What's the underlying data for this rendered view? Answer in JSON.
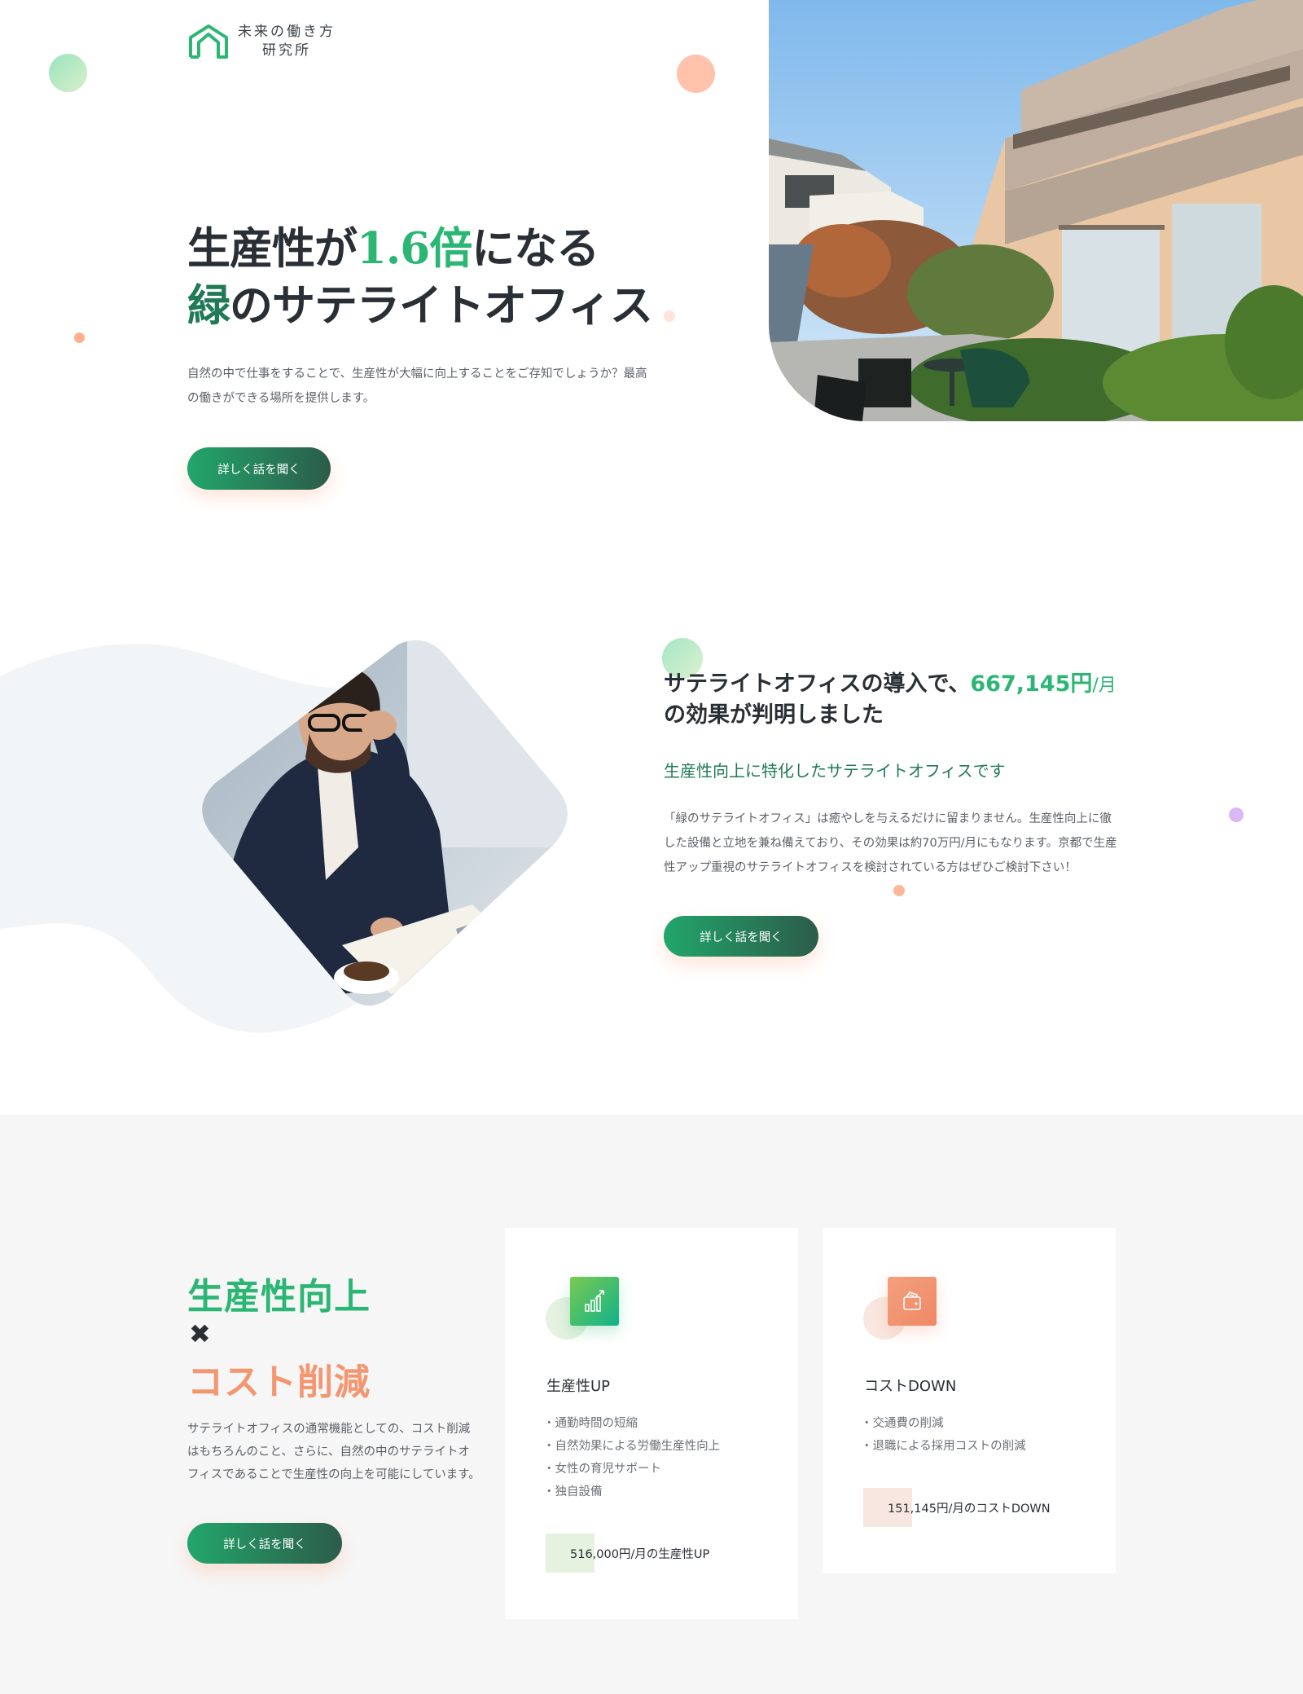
{
  "brand": {
    "name_line1": "未来の働き方",
    "name_line2": "研究所"
  },
  "hero": {
    "title_part1": "生産性が",
    "title_highlight": "1.6倍",
    "title_part2": "になる",
    "title_line2_accent": "緑",
    "title_line2_rest": "のサテライトオフィス",
    "description": "自然の中で仕事をすることで、生産性が大幅に向上することをご存知でしょうか？最高の働きができる場所を提供します。",
    "cta_label": "詳しく話を聞く"
  },
  "intro": {
    "title_part1": "サテライトオフィスの導入で、",
    "title_number": "667,145円",
    "title_unit": "/月",
    "title_line2": "の効果が判明しました",
    "subtitle": "生産性向上に特化したサテライトオフィスです",
    "description": "「緑のサテライトオフィス」は癒やしを与えるだけに留まりません。生産性向上に徹した設備と立地を兼ね備えており、その効果は約70万円/月にもなります。京都で生産性アップ重視のサテライトオフィスを検討されている方はぜひご検討下さい！",
    "cta_label": "詳しく話を聞く"
  },
  "features": {
    "heading_1": "生産性向上",
    "heading_x": "✖",
    "heading_2": "コスト削減",
    "description": "サテライトオフィスの通常機能としての、コスト削減はもちろんのこと、さらに、自然の中のサテライトオフィスであることで生産性の向上を可能にしています。",
    "cta_label": "詳しく話を聞く",
    "cards": [
      {
        "icon": "chart-up-icon",
        "title": "生産性UP",
        "items": [
          "通勤時間の短縮",
          "自然効果による労働生産性向上",
          "女性の育児サポート",
          "独自設備"
        ],
        "footer": "516,000円/月の生産性UP"
      },
      {
        "icon": "wallet-icon",
        "title": "コストDOWN",
        "items": [
          "交通費の削減",
          "退職による採用コストの削減"
        ],
        "footer": "151,145円/月のコストDOWN"
      }
    ]
  },
  "colors": {
    "brand_green": "#2bb673",
    "dark_green": "#1f7a55",
    "accent_orange": "#f4966f",
    "text_dark": "#2a2f35",
    "text_body": "#5c6168",
    "section_bg": "#f6f6f6"
  }
}
